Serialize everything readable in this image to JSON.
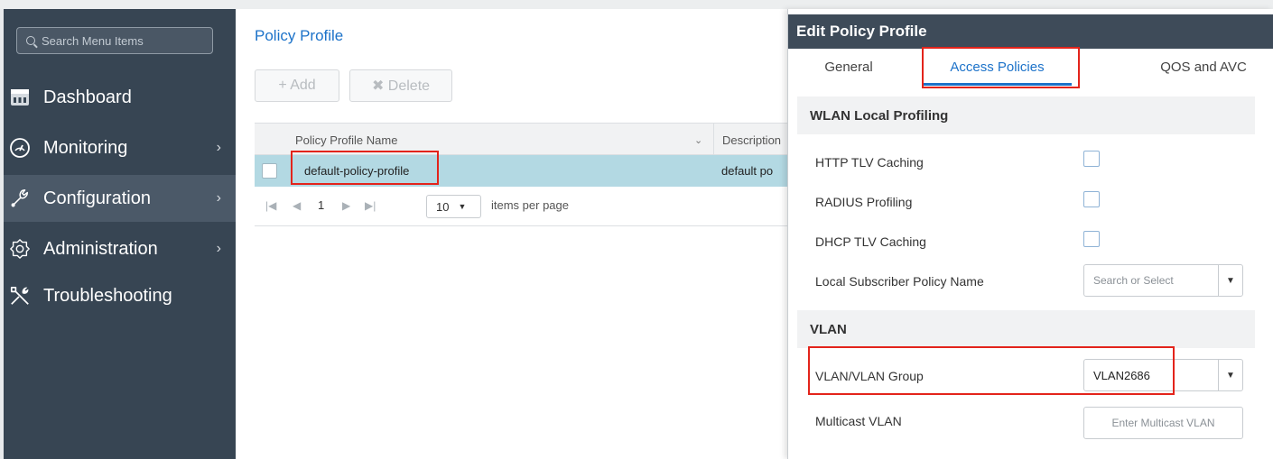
{
  "sidebar": {
    "search_placeholder": "Search Menu Items",
    "items": [
      {
        "label": "Dashboard",
        "icon": "dashboard-icon",
        "chevron": ""
      },
      {
        "label": "Monitoring",
        "icon": "gauge-icon",
        "chevron": "›"
      },
      {
        "label": "Configuration",
        "icon": "wrench-icon",
        "chevron": "›"
      },
      {
        "label": "Administration",
        "icon": "gear-icon",
        "chevron": "›"
      },
      {
        "label": "Troubleshooting",
        "icon": "tools-icon",
        "chevron": ""
      }
    ]
  },
  "main": {
    "title": "Policy Profile",
    "add_label": "+ Add",
    "delete_label": "✖ Delete",
    "columns": [
      "Policy Profile Name",
      "Description"
    ],
    "rows": [
      {
        "name": "default-policy-profile",
        "description": "default po"
      }
    ],
    "pager": {
      "current_page": "1",
      "page_size": "10",
      "items_per_page_label": "items per page"
    }
  },
  "panel": {
    "title": "Edit Policy Profile",
    "tabs": [
      "General",
      "Access Policies",
      "QOS and AVC"
    ],
    "active_tab": "Access Policies",
    "sections": {
      "profiling": "WLAN Local Profiling",
      "vlan": "VLAN"
    },
    "fields": {
      "http_tlv": "HTTP TLV Caching",
      "radius": "RADIUS Profiling",
      "dhcp_tlv": "DHCP TLV Caching",
      "local_subscriber": "Local Subscriber Policy Name",
      "local_subscriber_placeholder": "Search or Select",
      "vlan_group": "VLAN/VLAN Group",
      "vlan_group_value": "VLAN2686",
      "multicast_vlan": "Multicast VLAN",
      "multicast_placeholder": "Enter Multicast VLAN"
    }
  },
  "colors": {
    "sidebar_bg": "#374553",
    "accent": "#1c72c9",
    "highlight": "#e3241b",
    "selected_row": "#b3d9e3"
  }
}
